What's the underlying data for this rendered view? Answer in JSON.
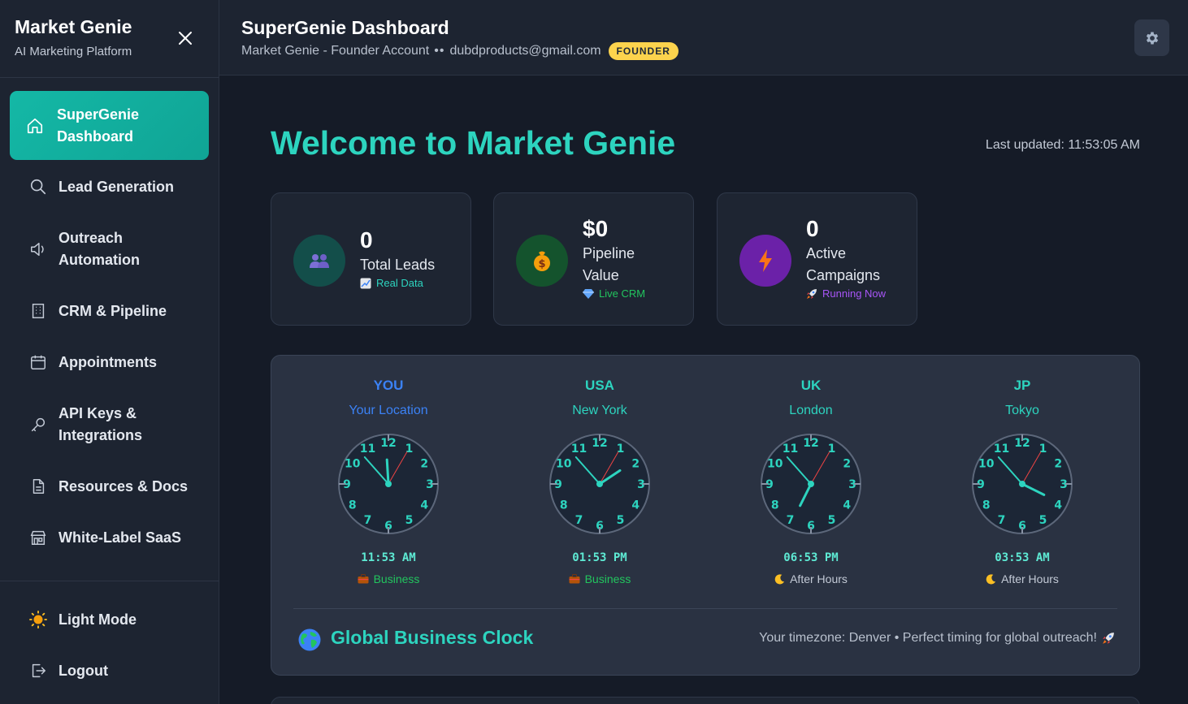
{
  "sidebar": {
    "brand_title": "Market Genie",
    "brand_subtitle": "AI Marketing Platform",
    "items": [
      {
        "label": "SuperGenie Dashboard",
        "icon": "home-icon",
        "active": true
      },
      {
        "label": "Lead Generation",
        "icon": "search-icon"
      },
      {
        "label": "Outreach Automation",
        "icon": "megaphone-icon"
      },
      {
        "label": "CRM & Pipeline",
        "icon": "building-icon"
      },
      {
        "label": "Appointments",
        "icon": "calendar-icon"
      },
      {
        "label": "API Keys & Integrations",
        "icon": "key-icon"
      },
      {
        "label": "Resources & Docs",
        "icon": "document-icon"
      },
      {
        "label": "White-Label SaaS",
        "icon": "storefront-icon"
      }
    ],
    "bottom": [
      {
        "label": "Light Mode",
        "icon": "sun-icon"
      },
      {
        "label": "Logout",
        "icon": "logout-icon"
      }
    ]
  },
  "header": {
    "title": "SuperGenie Dashboard",
    "account": "Market Genie - Founder Account",
    "separator": "••",
    "email": "dubdproducts@gmail.com",
    "badge": "FOUNDER"
  },
  "main": {
    "welcome": "Welcome to Market Genie",
    "last_updated": "Last updated: 11:53:05 AM",
    "stats": [
      {
        "value": "0",
        "label": "Total Leads",
        "note": "Real Data",
        "note_color": "#2dd4bf",
        "icon": "people-icon",
        "icon_bg": "#134e4a"
      },
      {
        "value": "$0",
        "label": "Pipeline Value",
        "note": "Live CRM",
        "note_color": "#22c55e",
        "icon": "money-bag-icon",
        "icon_bg": "#14532d"
      },
      {
        "value": "0",
        "label": "Active Campaigns",
        "note": "Running Now",
        "note_color": "#a855f7",
        "icon": "lightning-icon",
        "icon_bg": "#6b21a8"
      }
    ],
    "clocks": [
      {
        "code": "YOU",
        "city": "Your Location",
        "time": "11:53 AM",
        "status": "Business",
        "hours": 11,
        "minutes": 53,
        "seconds": 5,
        "accent": "#3b82f6",
        "status_color": "#22c55e",
        "status_icon": "briefcase-icon"
      },
      {
        "code": "USA",
        "city": "New York",
        "time": "01:53 PM",
        "status": "Business",
        "hours": 13,
        "minutes": 53,
        "seconds": 5,
        "accent": "#2dd4bf",
        "status_color": "#22c55e",
        "status_icon": "briefcase-icon"
      },
      {
        "code": "UK",
        "city": "London",
        "time": "06:53 PM",
        "status": "After Hours",
        "hours": 18,
        "minutes": 53,
        "seconds": 5,
        "accent": "#2dd4bf",
        "status_color": "#c3cad6",
        "status_icon": "moon-icon"
      },
      {
        "code": "JP",
        "city": "Tokyo",
        "time": "03:53 AM",
        "status": "After Hours",
        "hours": 3,
        "minutes": 53,
        "seconds": 5,
        "accent": "#2dd4bf",
        "status_color": "#c3cad6",
        "status_icon": "moon-icon"
      }
    ],
    "global_clock_title": "Global Business Clock",
    "global_clock_note": "Your timezone: Denver • Perfect timing for global outreach!"
  },
  "colors": {
    "accent": "#2dd4bf",
    "badge": "#fcd34d",
    "sidebar_active": "#14b8a6"
  }
}
